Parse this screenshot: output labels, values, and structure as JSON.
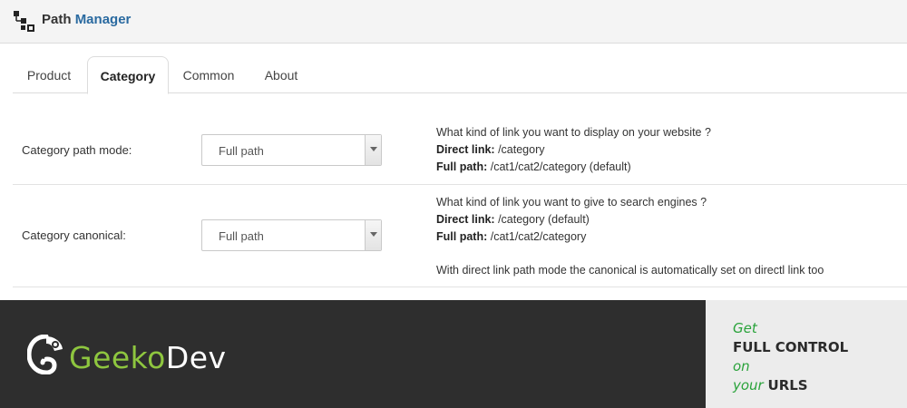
{
  "app": {
    "title_prefix": "Path",
    "title_accent": "Manager",
    "icon": "sitemap-icon"
  },
  "tabs": [
    {
      "label": "Product",
      "active": false
    },
    {
      "label": "Category",
      "active": true
    },
    {
      "label": "Common",
      "active": false
    },
    {
      "label": "About",
      "active": false
    }
  ],
  "settings": {
    "path_mode": {
      "label": "Category path mode:",
      "value": "Full path",
      "help_question": "What kind of link you want to display on your website ?",
      "direct_label": "Direct link:",
      "direct_value": " /category",
      "full_label": "Full path:",
      "full_value": " /cat1/cat2/category (default)"
    },
    "canonical": {
      "label": "Category canonical:",
      "value": "Full path",
      "help_question": "What kind of link you want to give to search engines ?",
      "direct_label": "Direct link:",
      "direct_value": " /category (default)",
      "full_label": "Full path:",
      "full_value": " /cat1/cat2/category",
      "note": "With direct link path mode the canonical is automatically set on directl link too"
    }
  },
  "banner": {
    "brand_geeko": "Geeko",
    "brand_dev": "Dev",
    "brand_icon": "chameleon-logo-icon",
    "tagline": {
      "get": "Get",
      "full_control": "FULL CONTROL",
      "on": "on",
      "your": "your",
      "urls": "URLS"
    }
  },
  "colors": {
    "accent_blue": "#2a6aa0",
    "brand_green": "#8ec63f",
    "tagline_green": "#2aa33b",
    "banner_dark": "#2e2e2e"
  }
}
